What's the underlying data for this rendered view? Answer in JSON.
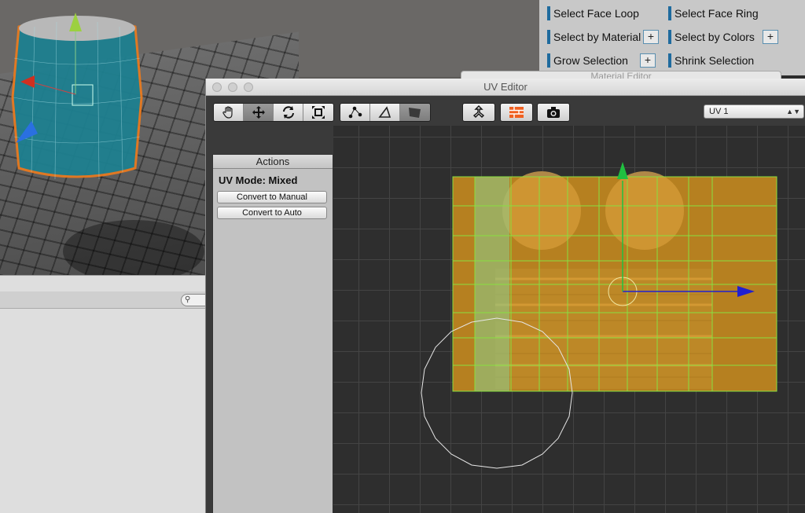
{
  "probuilder": {
    "select_face_loop": "Select Face Loop",
    "select_face_ring": "Select Face Ring",
    "select_by_material": "Select by Material",
    "select_by_colors": "Select by Colors",
    "grow_selection": "Grow Selection",
    "shrink_selection": "Shrink Selection",
    "plus": "+"
  },
  "material_editor": {
    "title": "Material Editor"
  },
  "uv_editor": {
    "title": "UV Editor",
    "channel_select": "UV 1",
    "actions": {
      "header": "Actions",
      "mode": "UV Mode: Mixed",
      "convert_manual": "Convert to Manual",
      "convert_auto": "Convert to Auto"
    }
  },
  "colors": {
    "selection": "#e8a020",
    "grid_line": "#88e040",
    "handle_x": "#2020d0",
    "handle_y": "#20c040",
    "accent_bar": "#1f6b9e",
    "render_icon": "#f06020"
  },
  "icons": {
    "toolbar_left": [
      "hand-icon",
      "move-icon",
      "rotate-icon",
      "scale-icon"
    ],
    "toolbar_mid": [
      "vertex-icon",
      "edge-icon",
      "face-icon"
    ],
    "toolbar_right": [
      "auto-unwrap-icon",
      "render-uv-icon",
      "screenshot-icon"
    ]
  }
}
